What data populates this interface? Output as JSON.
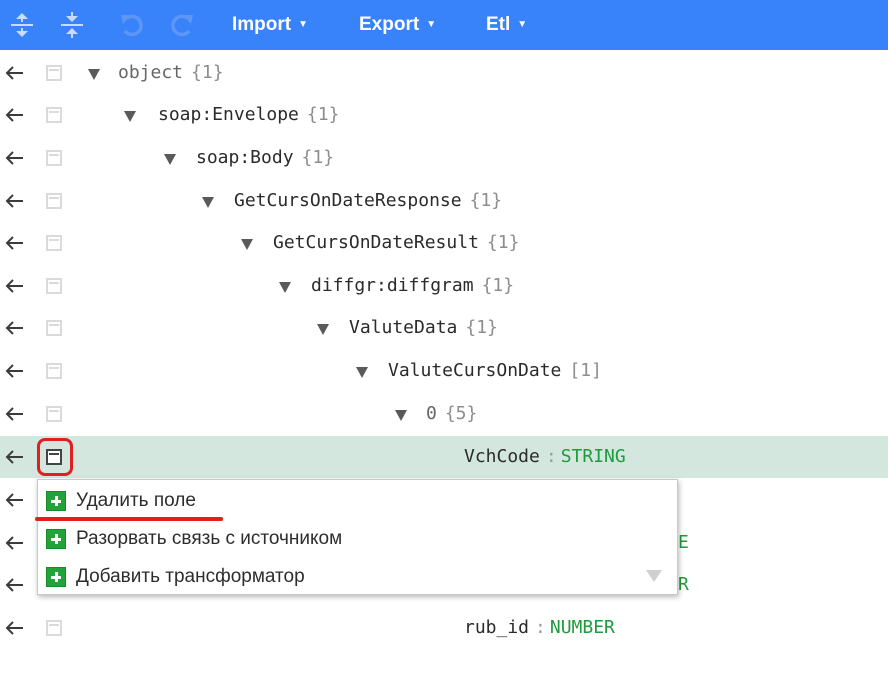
{
  "toolbar": {
    "icons": [
      "expand-all-icon",
      "collapse-all-icon",
      "undo-icon",
      "redo-icon"
    ],
    "menus": [
      {
        "label": "Import"
      },
      {
        "label": "Export"
      },
      {
        "label": "Etl"
      }
    ]
  },
  "tree": [
    {
      "key": "object",
      "count": "{1}"
    },
    {
      "key": "soap:Envelope",
      "count": "{1}"
    },
    {
      "key": "soap:Body",
      "count": "{1}"
    },
    {
      "key": "GetCursOnDateResponse",
      "count": "{1}"
    },
    {
      "key": "GetCursOnDateResult",
      "count": "{1}"
    },
    {
      "key": "diffgr:diffgram",
      "count": "{1}"
    },
    {
      "key": "ValuteData",
      "count": "{1}"
    },
    {
      "key": "ValuteCursOnDate",
      "count": "[1]"
    },
    {
      "key": "0",
      "count": "{5}"
    },
    {
      "key": "VchCode",
      "type": "STRING"
    },
    {
      "key": "",
      "type": "E"
    },
    {
      "key": "",
      "type": "R"
    },
    {
      "key": "rub_id",
      "type": "NUMBER"
    }
  ],
  "context_menu": {
    "items": [
      {
        "label": "Удалить поле"
      },
      {
        "label": "Разорвать связь с источником"
      },
      {
        "label": "Добавить трансформатор"
      }
    ]
  },
  "colors": {
    "toolbar": "#3883fa",
    "selected_row": "#d3e7df",
    "type_text": "#1e9b3c",
    "highlight": "#e02020",
    "plus_icon": "#21a33a"
  }
}
